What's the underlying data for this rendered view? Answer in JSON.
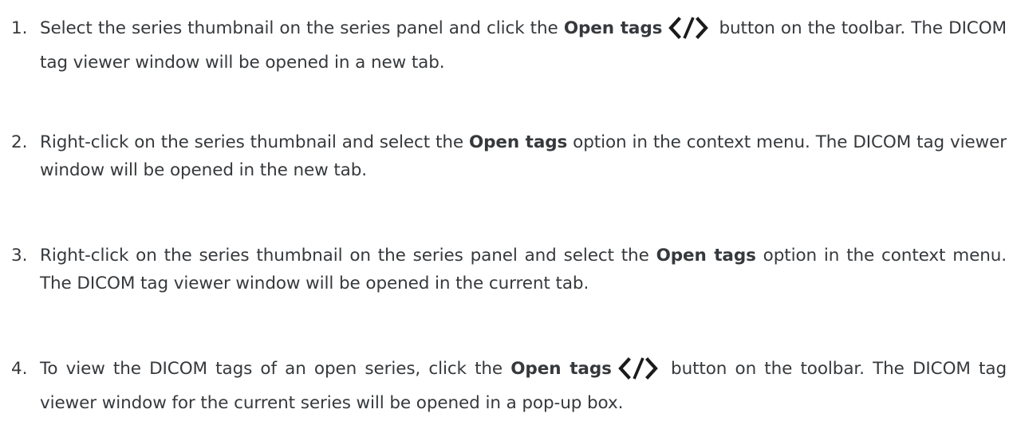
{
  "steps": [
    {
      "number": "1.",
      "before": "Select the series thumbnail on the series panel and click the ",
      "bold": "Open tags",
      "icon": "code-tag-icon",
      "after": " button on the toolbar. The DICOM tag viewer window will be opened in a new tab."
    },
    {
      "number": "2.",
      "before": "Right-click on the series thumbnail and select the ",
      "bold": "Open tags",
      "after": " option in the context menu. The DICOM tag viewer window will be opened in the new tab."
    },
    {
      "number": "3.",
      "before": "Right-click on the series thumbnail on the series panel and select the ",
      "bold": "Open tags",
      "after": " option in the context menu. The DICOM tag viewer window will be opened in the current tab."
    },
    {
      "number": "4.",
      "before": "To view the DICOM tags of an open series, click the ",
      "bold": "Open tags",
      "icon": "code-tag-icon",
      "after": " button on the toolbar. The DICOM tag viewer window for the current series will be opened in a pop-up box."
    }
  ]
}
